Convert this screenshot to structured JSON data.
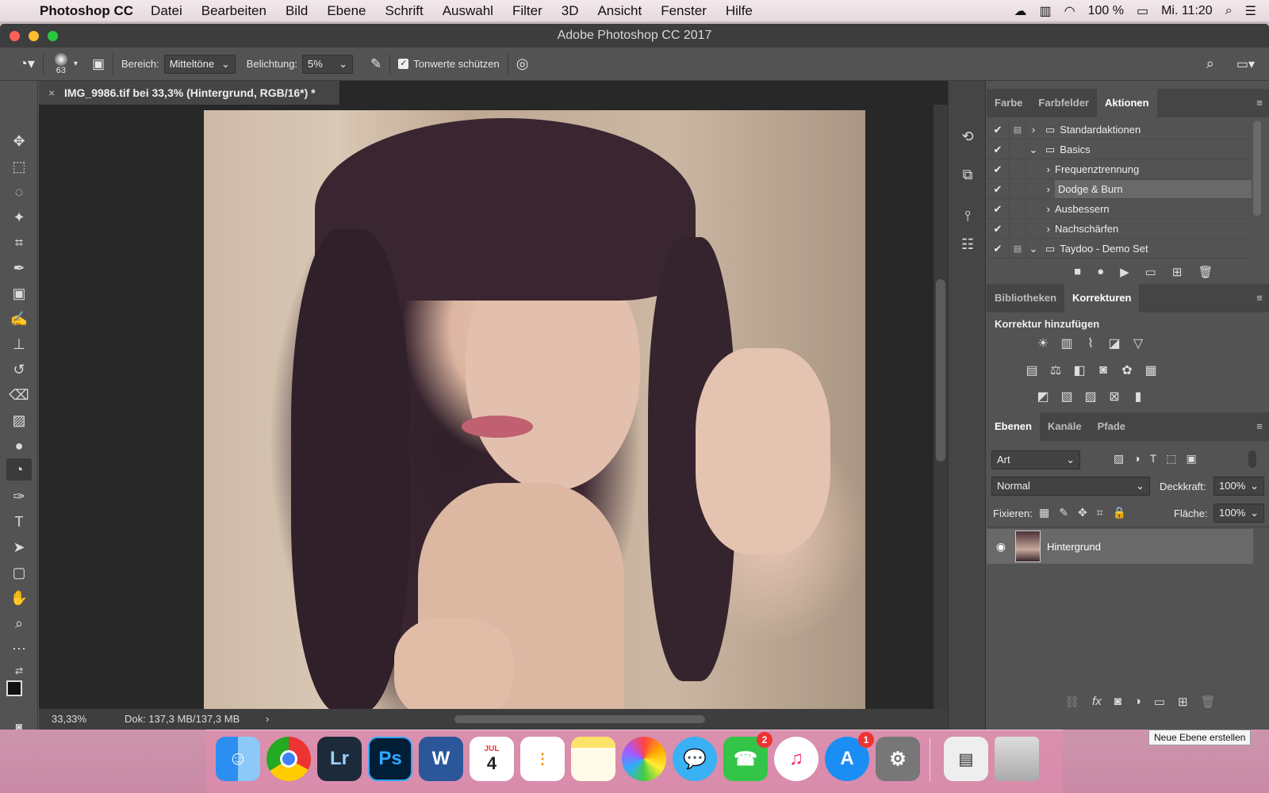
{
  "menubar": {
    "app_name": "Photoshop CC",
    "items": [
      "Datei",
      "Bearbeiten",
      "Bild",
      "Ebene",
      "Schrift",
      "Auswahl",
      "Filter",
      "3D",
      "Ansicht",
      "Fenster",
      "Hilfe"
    ],
    "battery": "100 %",
    "clock": "Mi. 11:20"
  },
  "window": {
    "title": "Adobe Photoshop CC 2017"
  },
  "options": {
    "brush_size": "63",
    "range_label": "Bereich:",
    "range_value": "Mitteltöne",
    "exposure_label": "Belichtung:",
    "exposure_value": "5%",
    "protect_tones_label": "Tonwerte schützen"
  },
  "document": {
    "tab_title": "IMG_9986.tif bei 33,3% (Hintergrund, RGB/16*) *",
    "zoom": "33,33%",
    "doc_info": "Dok: 137,3 MB/137,3 MB"
  },
  "actions_panel": {
    "tabs": [
      "Farbe",
      "Farbfelder",
      "Aktionen"
    ],
    "active_tab": "Aktionen",
    "items": [
      {
        "label": "Standardaktionen",
        "indent": 0,
        "expanded": false,
        "folder": true
      },
      {
        "label": "Basics",
        "indent": 0,
        "expanded": true,
        "folder": true
      },
      {
        "label": "Frequenztrennung",
        "indent": 1,
        "expanded": false,
        "folder": false
      },
      {
        "label": "Dodge & Burn",
        "indent": 1,
        "expanded": false,
        "folder": false,
        "highlighted": true
      },
      {
        "label": "Ausbessern",
        "indent": 1,
        "expanded": false,
        "folder": false
      },
      {
        "label": "Nachschärfen",
        "indent": 1,
        "expanded": false,
        "folder": false
      },
      {
        "label": "Taydoo - Demo Set",
        "indent": 0,
        "expanded": true,
        "folder": true
      }
    ]
  },
  "adjust_panel": {
    "tabs": [
      "Bibliotheken",
      "Korrekturen"
    ],
    "active_tab": "Korrekturen",
    "heading": "Korrektur hinzufügen"
  },
  "layers_panel": {
    "tabs": [
      "Ebenen",
      "Kanäle",
      "Pfade"
    ],
    "active_tab": "Ebenen",
    "filter_kind": "Art",
    "blend_mode": "Normal",
    "opacity_label": "Deckkraft:",
    "opacity_value": "100%",
    "lock_label": "Fixieren:",
    "fill_label": "Fläche:",
    "fill_value": "100%",
    "layers": [
      {
        "name": "Hintergrund",
        "visible": true
      }
    ],
    "tooltip": "Neue Ebene erstellen"
  },
  "dock": {
    "apps": [
      "finder-icon",
      "chrome-icon",
      "lightroom-icon",
      "photoshop-icon",
      "word-icon",
      "calendar-icon",
      "reminders-icon",
      "notes-icon",
      "photos-icon",
      "messages-icon",
      "facetime-icon",
      "itunes-icon",
      "appstore-icon",
      "system-prefs-icon",
      "documents-icon",
      "trash-icon"
    ],
    "calendar_month": "JUL",
    "calendar_day": "4",
    "facetime_badge": "2",
    "appstore_badge": "1",
    "lr_label": "Lr",
    "ps_label": "Ps",
    "word_label": "W"
  }
}
